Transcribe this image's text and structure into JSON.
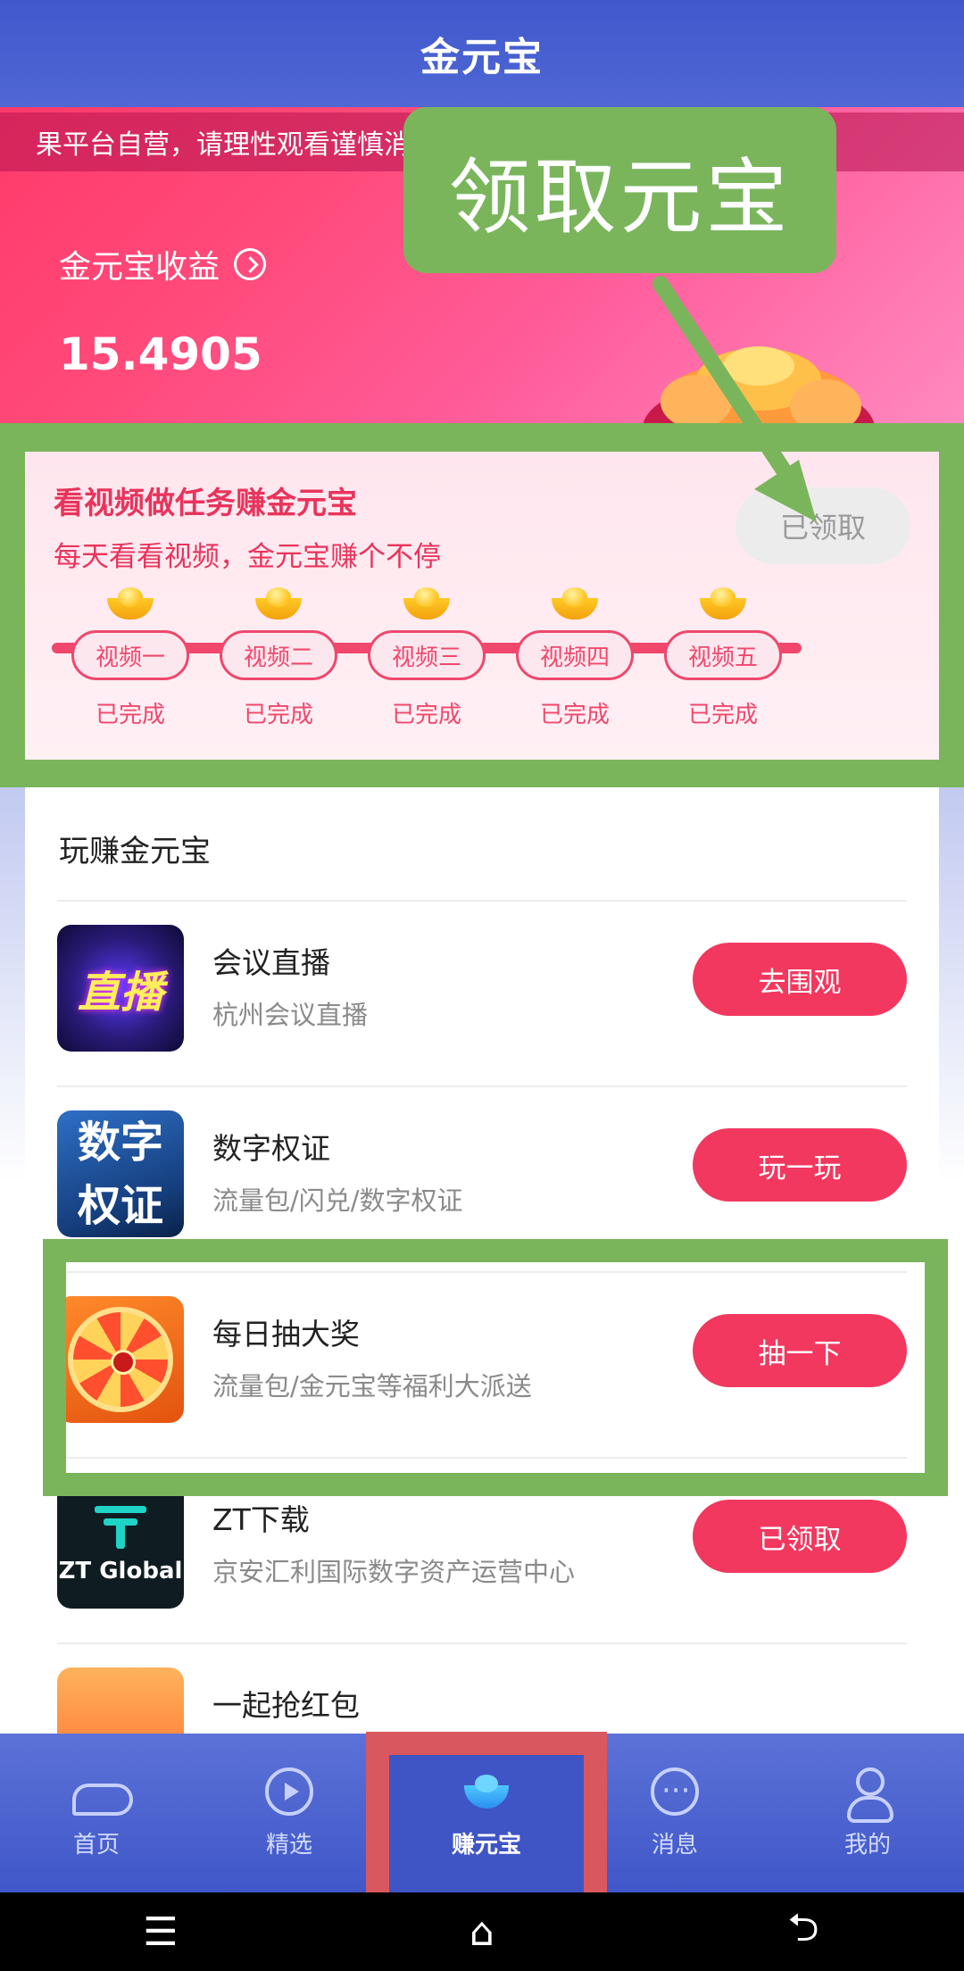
{
  "header": {
    "title": "金元宝"
  },
  "hero": {
    "marquee": "果平台自营，请理性观看谨慎消费，风险提示：视频",
    "earnings_label": "金元宝收益",
    "earnings_value": "15.4905"
  },
  "annotation": {
    "label": "领取元宝"
  },
  "task": {
    "title": "看视频做任务赚金元宝",
    "subtitle": "每天看看视频，金元宝赚个不停",
    "claim_button": "已领取",
    "steps": [
      {
        "label": "视频一",
        "status": "已完成"
      },
      {
        "label": "视频二",
        "status": "已完成"
      },
      {
        "label": "视频三",
        "status": "已完成"
      },
      {
        "label": "视频四",
        "status": "已完成"
      },
      {
        "label": "视频五",
        "status": "已完成"
      }
    ]
  },
  "list": {
    "heading": "玩赚金元宝",
    "items": [
      {
        "name": "会议直播",
        "desc": "杭州会议直播",
        "button": "去围观",
        "icon_text": "直播"
      },
      {
        "name": "数字权证",
        "desc": "流量包/闪兑/数字权证",
        "button": "玩一玩",
        "icon_text_1": "数字",
        "icon_text_2": "权证"
      },
      {
        "name": "每日抽大奖",
        "desc": "流量包/金元宝等福利大派送",
        "button": "抽一下"
      },
      {
        "name": "ZT下载",
        "desc": "京安汇利国际数字资产运营中心",
        "button": "已领取",
        "icon_text": "ZT Global"
      },
      {
        "name": "一起抢红包",
        "desc": "",
        "button": ""
      }
    ]
  },
  "nav": {
    "items": [
      {
        "label": "首页",
        "icon": "whale-icon"
      },
      {
        "label": "精选",
        "icon": "play-icon"
      },
      {
        "label": "赚元宝",
        "icon": "ingot-icon"
      },
      {
        "label": "消息",
        "icon": "message-icon"
      },
      {
        "label": "我的",
        "icon": "user-icon"
      }
    ],
    "active_index": 2
  },
  "system": {
    "menu": "☰",
    "home": "⌂",
    "back": "⮌"
  },
  "colors": {
    "accent": "#f2385f",
    "highlight_green": "#7ab55c",
    "highlight_red": "#d9575e",
    "nav_blue": "#3f57c8"
  }
}
